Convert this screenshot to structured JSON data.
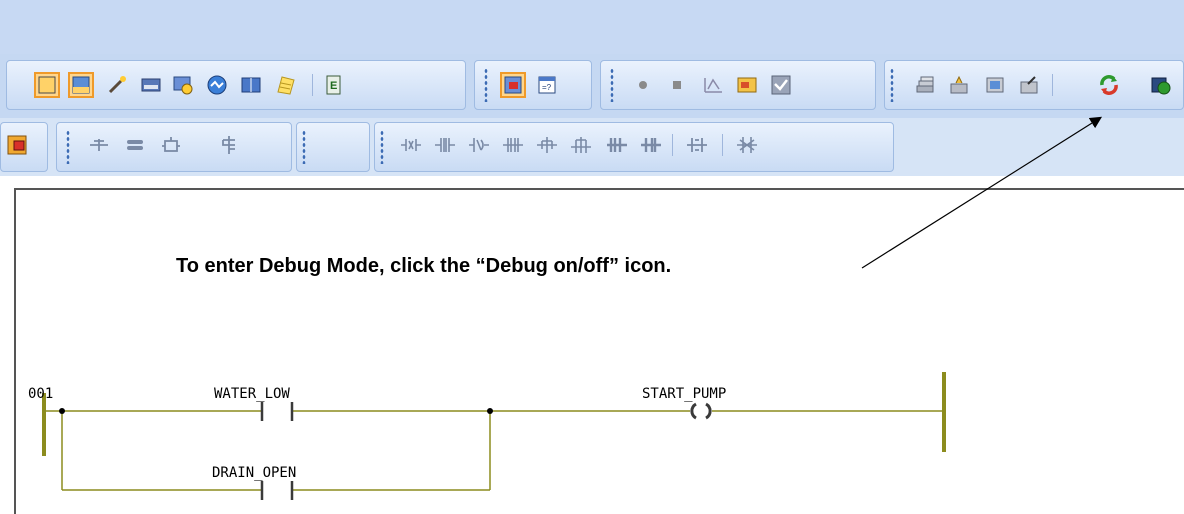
{
  "toolbar": {
    "row1_icons": [
      "window-icon",
      "layout-icon",
      "magic-wand-icon",
      "keyboard-icon",
      "view-icon",
      "globe-icon",
      "panel-icon",
      "note-icon",
      "ladder-editor-icon",
      "io-monitor-icon",
      "form-icon",
      "record-icon",
      "stop-icon",
      "chart-icon",
      "card-icon",
      "check-shield-icon",
      "stack-icon",
      "transfer-icon",
      "grid-icon",
      "export-icon",
      "debug-toggle-icon",
      "simulate-icon"
    ],
    "row2_icons": [
      "function-block-icon",
      "insert-rung-icon",
      "insert-branch-icon",
      "insert-element-icon",
      "edit-rung-icon",
      "contact-no-icon",
      "contact-nc-icon",
      "contact-pos-icon",
      "contact-neg-icon",
      "coil-icon",
      "coil-set-icon",
      "contact-h-icon",
      "contact-hh-icon",
      "block-icon",
      "delete-icon"
    ]
  },
  "annotation": {
    "text": "To enter Debug Mode, click the “Debug on/off” icon."
  },
  "ladder": {
    "rung_number": "001",
    "contacts": [
      {
        "label": "WATER_LOW"
      },
      {
        "label": "DRAIN_OPEN"
      }
    ],
    "coil": {
      "label": "START_PUMP"
    }
  },
  "colors": {
    "rail": "#8c8c1e",
    "wire": "#8c8c1e",
    "coil": "#3a3a3a",
    "toolbar": "#c5d8f2",
    "highlight": "#ef9a2a"
  }
}
